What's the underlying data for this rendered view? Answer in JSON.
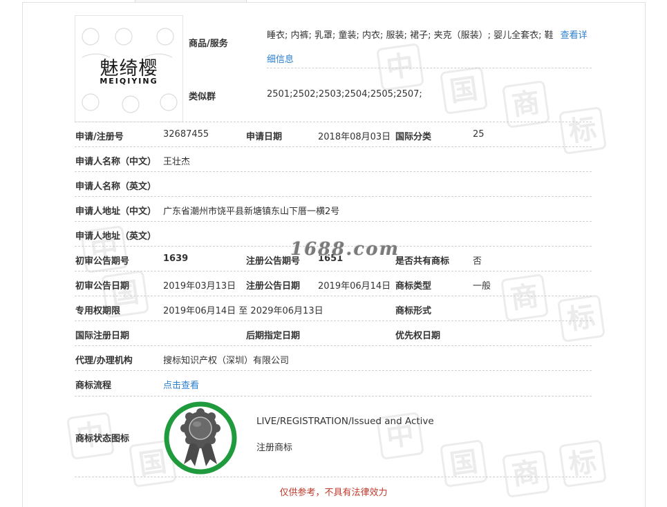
{
  "logo": {
    "chinese": "魅绮樱",
    "pinyin": "MEIQIYING"
  },
  "goods": {
    "label": "商品/服务",
    "value": "睡衣; 内裤; 乳罩; 童装; 内衣; 服装; 裙子; 夹克（服装）; 婴儿全套衣; 鞋",
    "link": "查看详细信息"
  },
  "similar": {
    "label": "类似群",
    "value": "2501;2502;2503;2504;2505;2507;"
  },
  "app_no": {
    "label": "申请/注册号",
    "value": "32687455"
  },
  "app_date": {
    "label": "申请日期",
    "value": "2018年08月03日"
  },
  "intl_class": {
    "label": "国际分类",
    "value": "25"
  },
  "applicant_cn": {
    "label": "申请人名称（中文）",
    "value": "王壮杰"
  },
  "applicant_en": {
    "label": "申请人名称（英文）",
    "value": ""
  },
  "address_cn": {
    "label": "申请人地址（中文）",
    "value": "广东省潮州市饶平县新塘镇东山下厝一横2号"
  },
  "address_en": {
    "label": "申请人地址（英文）",
    "value": ""
  },
  "prelim_no": {
    "label": "初审公告期号",
    "value": "1639"
  },
  "reg_no": {
    "label": "注册公告期号",
    "value": "1651"
  },
  "shared": {
    "label": "是否共有商标",
    "value": "否"
  },
  "prelim_date": {
    "label": "初审公告日期",
    "value": "2019年03月13日"
  },
  "reg_date": {
    "label": "注册公告日期",
    "value": "2019年06月14日"
  },
  "tm_type": {
    "label": "商标类型",
    "value": "一般"
  },
  "validity": {
    "label": "专用权期限",
    "value": "2019年06月14日 至 2029年06月13日"
  },
  "tm_form": {
    "label": "商标形式",
    "value": ""
  },
  "intl_reg_date": {
    "label": "国际注册日期",
    "value": ""
  },
  "later_date": {
    "label": "后期指定日期",
    "value": ""
  },
  "priority_date": {
    "label": "优先权日期",
    "value": ""
  },
  "agency": {
    "label": "代理/办理机构",
    "value": "搜标知识产权（深圳）有限公司"
  },
  "process": {
    "label": "商标流程",
    "link": "点击查看"
  },
  "status": {
    "label": "商标状态图标",
    "en": "LIVE/REGISTRATION/Issued and Active",
    "cn": "注册商标",
    "ring_color": "#1f9a3c"
  },
  "watermark": "1688.com",
  "disclaimer": "仅供参考，不具有法律效力"
}
